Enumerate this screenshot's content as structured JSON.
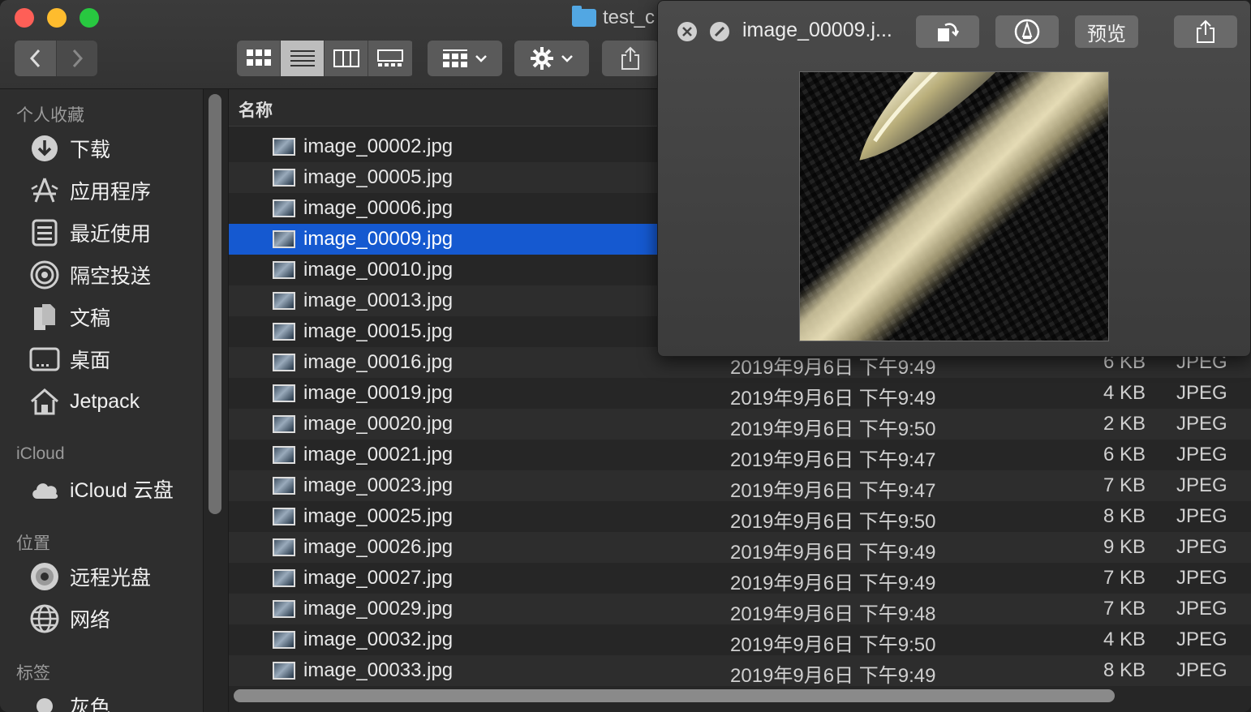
{
  "window": {
    "folder_title": "test_c"
  },
  "toolbar": {
    "back_icon": "chevron-left-icon",
    "forward_icon": "chevron-right-icon"
  },
  "sidebar": {
    "sections": {
      "favorites": "个人收藏",
      "icloud": "iCloud",
      "locations": "位置",
      "tags": "标签"
    },
    "favorites": [
      {
        "label": "下载",
        "icon": "download-icon"
      },
      {
        "label": "应用程序",
        "icon": "applications-icon"
      },
      {
        "label": "最近使用",
        "icon": "recents-icon"
      },
      {
        "label": "隔空投送",
        "icon": "airdrop-icon"
      },
      {
        "label": "文稿",
        "icon": "documents-icon"
      },
      {
        "label": "桌面",
        "icon": "desktop-icon"
      },
      {
        "label": "Jetpack",
        "icon": "home-icon"
      }
    ],
    "icloud_items": [
      {
        "label": "iCloud 云盘",
        "icon": "cloud-icon"
      }
    ],
    "locations": [
      {
        "label": "远程光盘",
        "icon": "disc-icon"
      },
      {
        "label": "网络",
        "icon": "network-icon"
      }
    ],
    "tags_partial": "灰色"
  },
  "list": {
    "header_name": "名称",
    "rows": [
      {
        "name": "image_00002.jpg",
        "date": "",
        "size": "",
        "kind": ""
      },
      {
        "name": "image_00005.jpg",
        "date": "",
        "size": "",
        "kind": ""
      },
      {
        "name": "image_00006.jpg",
        "date": "",
        "size": "",
        "kind": ""
      },
      {
        "name": "image_00009.jpg",
        "date": "",
        "size": "",
        "kind": "",
        "selected": true
      },
      {
        "name": "image_00010.jpg",
        "date": "",
        "size": "",
        "kind": ""
      },
      {
        "name": "image_00013.jpg",
        "date": "",
        "size": "",
        "kind": ""
      },
      {
        "name": "image_00015.jpg",
        "date": "",
        "size": "",
        "kind": ""
      },
      {
        "name": "image_00016.jpg",
        "date": "2019年9月6日 下午9:49",
        "size": "6 KB",
        "kind": "JPEG"
      },
      {
        "name": "image_00019.jpg",
        "date": "2019年9月6日 下午9:49",
        "size": "4 KB",
        "kind": "JPEG"
      },
      {
        "name": "image_00020.jpg",
        "date": "2019年9月6日 下午9:50",
        "size": "2 KB",
        "kind": "JPEG"
      },
      {
        "name": "image_00021.jpg",
        "date": "2019年9月6日 下午9:47",
        "size": "6 KB",
        "kind": "JPEG"
      },
      {
        "name": "image_00023.jpg",
        "date": "2019年9月6日 下午9:47",
        "size": "7 KB",
        "kind": "JPEG"
      },
      {
        "name": "image_00025.jpg",
        "date": "2019年9月6日 下午9:50",
        "size": "8 KB",
        "kind": "JPEG"
      },
      {
        "name": "image_00026.jpg",
        "date": "2019年9月6日 下午9:49",
        "size": "9 KB",
        "kind": "JPEG"
      },
      {
        "name": "image_00027.jpg",
        "date": "2019年9月6日 下午9:49",
        "size": "7 KB",
        "kind": "JPEG"
      },
      {
        "name": "image_00029.jpg",
        "date": "2019年9月6日 下午9:48",
        "size": "7 KB",
        "kind": "JPEG"
      },
      {
        "name": "image_00032.jpg",
        "date": "2019年9月6日 下午9:50",
        "size": "4 KB",
        "kind": "JPEG"
      },
      {
        "name": "image_00033.jpg",
        "date": "2019年9月6日 下午9:49",
        "size": "8 KB",
        "kind": "JPEG"
      }
    ]
  },
  "quicklook": {
    "title": "image_00009.j...",
    "rotate_icon": "rotate-icon",
    "markup_icon": "markup-icon",
    "open_with_label": "预览",
    "share_icon": "share-icon",
    "close_icon": "close-icon",
    "fullscreen_icon": "fullscreen-icon"
  },
  "colors": {
    "selection": "#1559d0",
    "window_bg": "#2b2b2b"
  }
}
